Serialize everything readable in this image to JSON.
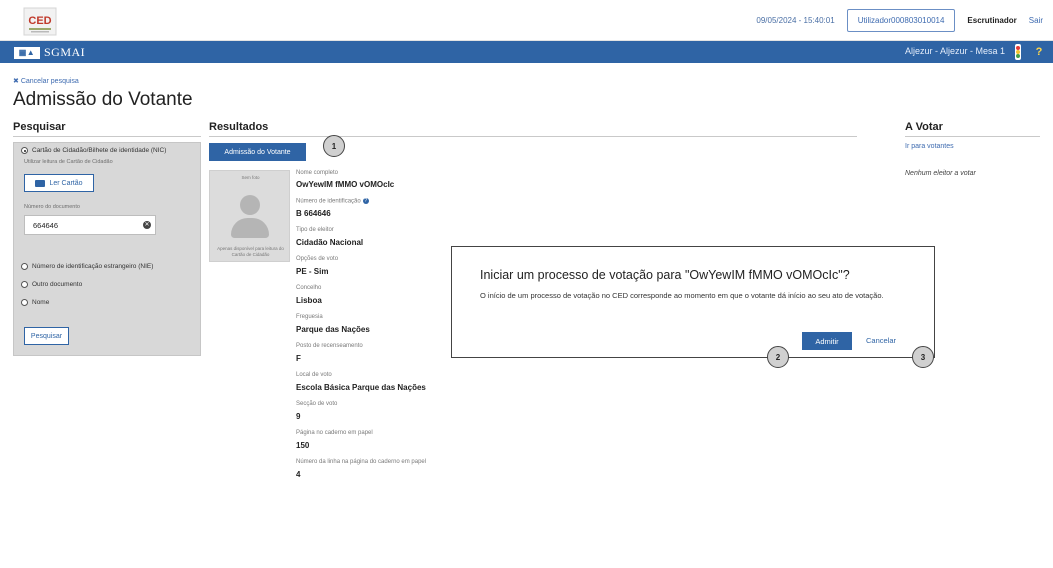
{
  "header": {
    "datetime": "09/05/2024 - 15:40:01",
    "user": "Utilizador000803010014",
    "role": "Escrutinador",
    "logout": "Sair",
    "logo_icon": "ced-logo",
    "logo_text": "CED"
  },
  "navbar": {
    "brand_mark": "SGMAI",
    "brand": "SGMAI",
    "location": "Aljezur - Aljezur - Mesa 1",
    "help": "?",
    "accent_color": "#2f64a5"
  },
  "page": {
    "cancel_search": "Cancelar pesquisa",
    "title": "Admissão do Votante"
  },
  "search": {
    "title": "Pesquisar",
    "option_nic": "Cartão de Cidadão/Bilhete de identidade (NIC)",
    "card_reader_hint": "Utilizar leitura de Cartão de Cidadão",
    "read_card": "Ler Cartão",
    "doc_number_label": "Número do documento",
    "doc_number_value": "664646",
    "option_nie": "Número de identificação estrangeiro (NIE)",
    "option_other": "Outro documento",
    "option_name": "Nome",
    "search_button": "Pesquisar"
  },
  "results": {
    "title": "Resultados",
    "admit_button": "Admissão do Votante",
    "photo_label": "Sem foto",
    "photo_note": "Apenas disponível para leitura do Cartão de Cidadão",
    "fields": [
      {
        "label": "Nome completo",
        "value": "OwYewIM fMMO vOMOcIc"
      },
      {
        "label": "Número de identificação",
        "value": "B 664646"
      },
      {
        "label": "Tipo de eleitor",
        "value": "Cidadão Nacional"
      },
      {
        "label": "Opções de voto",
        "value": "PE - Sim"
      },
      {
        "label": "Concelho",
        "value": "Lisboa"
      },
      {
        "label": "Freguesia",
        "value": "Parque das Nações"
      },
      {
        "label": "Posto de recenseamento",
        "value": "F"
      },
      {
        "label": "Local de voto",
        "value": "Escola Básica Parque das Nações"
      },
      {
        "label": "Secção de voto",
        "value": "9"
      },
      {
        "label": "Página no caderno em papel",
        "value": "150"
      },
      {
        "label": "Número da linha na página do caderno em papel",
        "value": "4"
      }
    ]
  },
  "to_vote": {
    "title": "A Votar",
    "link": "Ir para votantes",
    "empty": "Nenhum eleitor a votar"
  },
  "dialog": {
    "title": "Iniciar um processo de votação para \"OwYewIM fMMO vOMOcIc\"?",
    "text": "O início de um processo de votação no CED corresponde ao momento em que o votante dá início ao seu ato de votação.",
    "admit": "Admitir",
    "cancel": "Cancelar"
  },
  "callouts": [
    "1",
    "2",
    "3"
  ]
}
